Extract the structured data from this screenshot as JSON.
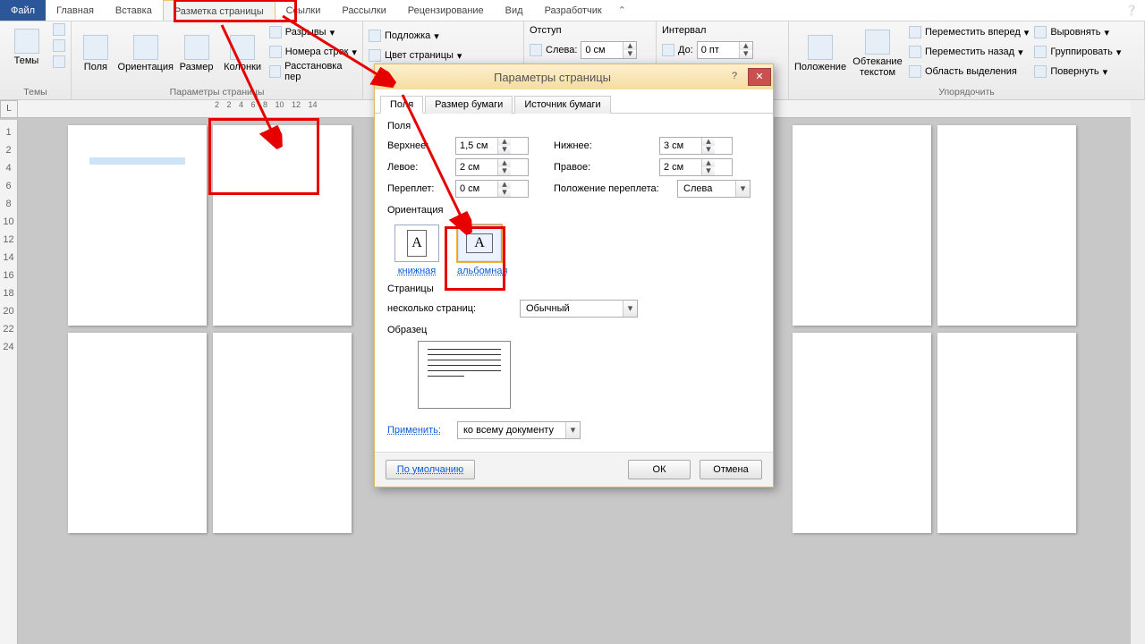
{
  "tabs": {
    "file": "Файл",
    "home": "Главная",
    "insert": "Вставка",
    "layout": "Разметка страницы",
    "refs": "Ссылки",
    "mail": "Рассылки",
    "review": "Рецензирование",
    "view": "Вид",
    "dev": "Разработчик"
  },
  "ribbon": {
    "themes": {
      "themes": "Темы",
      "group": "Темы"
    },
    "pagesetup": {
      "margins": "Поля",
      "orientation": "Ориентация",
      "size": "Размер",
      "columns": "Колонки",
      "breaks": "Разрывы",
      "linenum": "Номера строк",
      "hyphen": "Расстановка пер",
      "group": "Параметры страницы"
    },
    "bg": {
      "watermark": "Подложка",
      "pagecolor": "Цвет страницы"
    },
    "indent": {
      "title": "Отступ",
      "left": "Слева:",
      "left_v": "0 см"
    },
    "spacing": {
      "title": "Интервал",
      "before": "До:",
      "before_v": "0 пт"
    },
    "arrange": {
      "position": "Положение",
      "wrap": "Обтекание текстом",
      "forward": "Переместить вперед",
      "backward": "Переместить назад",
      "pane": "Область выделения",
      "align": "Выровнять",
      "grp": "Группировать",
      "rotate": "Повернуть",
      "group": "Упорядочить"
    }
  },
  "ruler_h": "2   2   4   6   8   10  12  14",
  "ruler_v": [
    "",
    "1",
    "2",
    "",
    "4",
    "",
    "6",
    "",
    "8",
    "",
    "10",
    "",
    "12",
    "",
    "14",
    "",
    "16",
    "",
    "18",
    "",
    "20",
    "",
    "22",
    "",
    "24"
  ],
  "dialog": {
    "title": "Параметры страницы",
    "tabs": {
      "fields": "Поля",
      "size": "Размер бумаги",
      "source": "Источник бумаги"
    },
    "margins": {
      "title": "Поля",
      "top": "Верхнее:",
      "top_v": "1,5 см",
      "bottom": "Нижнее:",
      "bottom_v": "3 см",
      "left": "Левое:",
      "left_v": "2 см",
      "right": "Правое:",
      "right_v": "2 см",
      "gutter": "Переплет:",
      "gutter_v": "0 см",
      "gutpos": "Положение переплета:",
      "gutpos_v": "Слева"
    },
    "orient": {
      "title": "Ориентация",
      "portrait": "книжная",
      "landscape": "альбомная"
    },
    "pages": {
      "title": "Страницы",
      "multi": "несколько страниц:",
      "multi_v": "Обычный"
    },
    "sample": "Образец",
    "apply": {
      "label": "Применить:",
      "value": "ко всему документу"
    },
    "default": "По умолчанию",
    "ok": "ОК",
    "cancel": "Отмена"
  }
}
